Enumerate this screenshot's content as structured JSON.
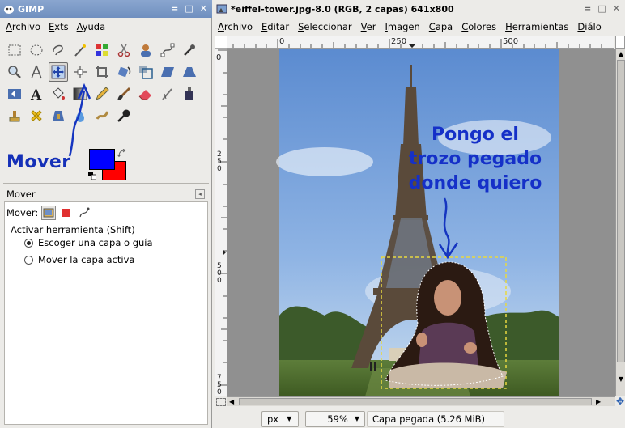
{
  "toolbox": {
    "title": "GIMP",
    "wm_buttons": [
      "=",
      "□",
      "✕"
    ],
    "menu": [
      "Archivo",
      "Exts",
      "Ayuda"
    ],
    "annotation_label": "Mover",
    "colors": {
      "foreground": "#0000ff",
      "background": "#ff0000"
    },
    "tools": [
      "rect-select-icon",
      "ellipse-select-icon",
      "free-select-icon",
      "fuzzy-select-icon",
      "select-by-color-icon",
      "scissors-icon",
      "foreground-select-icon",
      "paths-icon",
      "color-picker-icon",
      "zoom-icon",
      "measure-icon",
      "move-icon",
      "align-icon",
      "crop-icon",
      "rotate-icon",
      "scale-icon",
      "shear-icon",
      "perspective-icon",
      "flip-icon",
      "text-icon",
      "bucket-fill-icon",
      "blend-icon",
      "pencil-icon",
      "paintbrush-icon",
      "eraser-icon",
      "airbrush-icon",
      "ink-icon",
      "clone-icon",
      "heal-icon",
      "perspective-clone-icon",
      "blur-icon",
      "smudge-icon",
      "dodge-burn-icon"
    ],
    "active_tool": "move-icon"
  },
  "tool_options": {
    "header": "Mover",
    "mode_label": "Mover:",
    "activate_label": "Activar herramienta  (Shift)",
    "radio_1": "Escoger una capa o guía",
    "radio_2": "Mover la capa activa",
    "selected_radio": 1
  },
  "image_window": {
    "title": "*eiffel-tower.jpg-8.0 (RGB, 2 capas) 641x800",
    "wm_buttons": [
      "=",
      "□",
      "✕"
    ],
    "menu": [
      "Archivo",
      "Editar",
      "Seleccionar",
      "Ver",
      "Imagen",
      "Capa",
      "Colores",
      "Herramientas",
      "Diálo"
    ],
    "hruler_labels": [
      "0",
      "250",
      "500"
    ],
    "vruler_labels": [
      "0",
      "250",
      "500",
      "750"
    ],
    "annotation": [
      "Pongo el",
      "trozo pegado",
      "donde quiero"
    ],
    "status": {
      "unit": "px",
      "zoom": "59%",
      "message": "Capa pegada (5.26 MiB)"
    }
  }
}
